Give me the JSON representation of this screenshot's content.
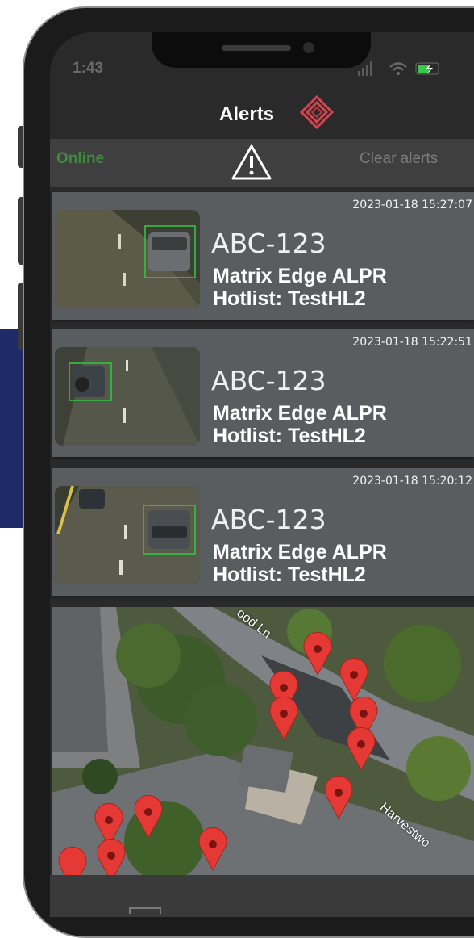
{
  "status_bar": {
    "time": "1:43"
  },
  "header": {
    "title": "Alerts",
    "logo_icon": "diamond-logo-icon",
    "logo_color": "#d9434f"
  },
  "toolbar": {
    "connection_status": "Online",
    "connection_color": "#3f8a3d",
    "warning_icon": "warning-triangle-icon",
    "clear_label": "Clear alerts"
  },
  "alerts": [
    {
      "timestamp": "2023-01-18 15:27:07",
      "plate": "ABC-123",
      "source": "Matrix Edge ALPR",
      "hotlist": "Hotlist: TestHL2"
    },
    {
      "timestamp": "2023-01-18 15:22:51",
      "plate": "ABC-123",
      "source": "Matrix Edge ALPR",
      "hotlist": "Hotlist: TestHL2"
    },
    {
      "timestamp": "2023-01-18 15:20:12",
      "plate": "ABC-123",
      "source": "Matrix Edge ALPR",
      "hotlist": "Hotlist: TestHL2"
    }
  ],
  "map": {
    "street_labels": [
      "ood Ln",
      "Harvestwo"
    ],
    "marker_color": "#e53935",
    "marker_count": 13
  }
}
